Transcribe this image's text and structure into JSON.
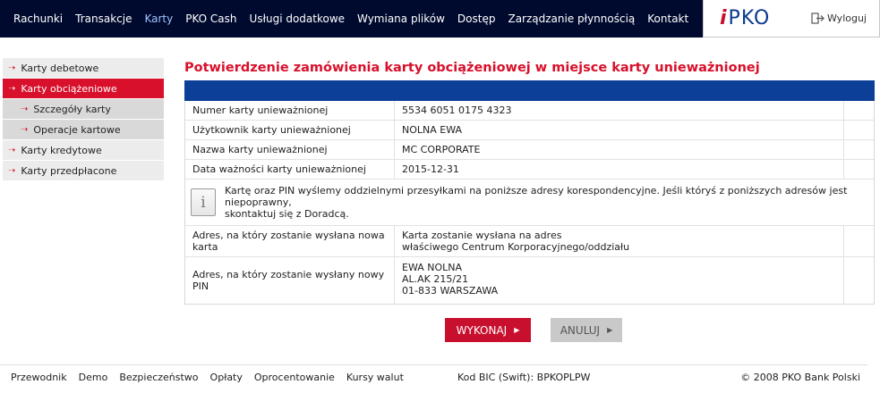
{
  "nav": {
    "items": [
      "Rachunki",
      "Transakcje",
      "Karty",
      "PKO Cash",
      "Usługi dodatkowe",
      "Wymiana plików",
      "Dostęp",
      "Zarządzanie płynnością",
      "Kontakt"
    ],
    "active": "Karty",
    "logo_i": "i",
    "logo_text": "PKO",
    "logout": "Wyloguj"
  },
  "sidebar": {
    "items": [
      {
        "label": "Karty debetowe"
      },
      {
        "label": "Karty obciążeniowe"
      },
      {
        "label": "Szczegóły karty"
      },
      {
        "label": "Operacje kartowe"
      },
      {
        "label": "Karty kredytowe"
      },
      {
        "label": "Karty przedpłacone"
      }
    ]
  },
  "main": {
    "title": "Potwierdzenie zamówienia karty obciążeniowej w miejsce karty unieważnionej",
    "rows": [
      {
        "label": "Numer karty unieważnionej",
        "value": "5534 6051 0175 4323"
      },
      {
        "label": "Użytkownik karty unieważnionej",
        "value": "NOLNA EWA"
      },
      {
        "label": "Nazwa karty unieważnionej",
        "value": "MC CORPORATE"
      },
      {
        "label": "Data ważności karty unieważnionej",
        "value": "2015-12-31"
      }
    ],
    "info_icon": "i",
    "info_line1": "Kartę oraz PIN wyślemy oddzielnymi przesyłkami na poniższe adresy korespondencyjne. Jeśli któryś z poniższych adresów jest niepoprawny,",
    "info_line2": "skontaktuj się z Doradcą.",
    "card_address": {
      "label_line1": "Adres, na który zostanie wysłana nowa",
      "label_line2": "karta",
      "value_line1": "Karta zostanie wysłana na adres",
      "value_line2": "właściwego Centrum Korporacyjnego/oddziału"
    },
    "pin_address": {
      "label": "Adres, na który zostanie wysłany nowy PIN",
      "line1": "EWA NOLNA",
      "line2": "AL.AK 215/21",
      "line3": "01-833 WARSZAWA"
    },
    "btn_execute": "WYKONAJ",
    "btn_cancel": "ANULUJ"
  },
  "footer": {
    "links": [
      "Przewodnik",
      "Demo",
      "Bezpieczeństwo",
      "Opłaty",
      "Oprocentowanie",
      "Kursy walut"
    ],
    "bic": "Kod BIC (Swift): BPKOPLPW",
    "copyright": "© 2008 PKO Bank Polski"
  },
  "colors": {
    "nav_bg": "#000a2e",
    "accent_red": "#d8102b",
    "band_blue": "#0c3f98"
  }
}
